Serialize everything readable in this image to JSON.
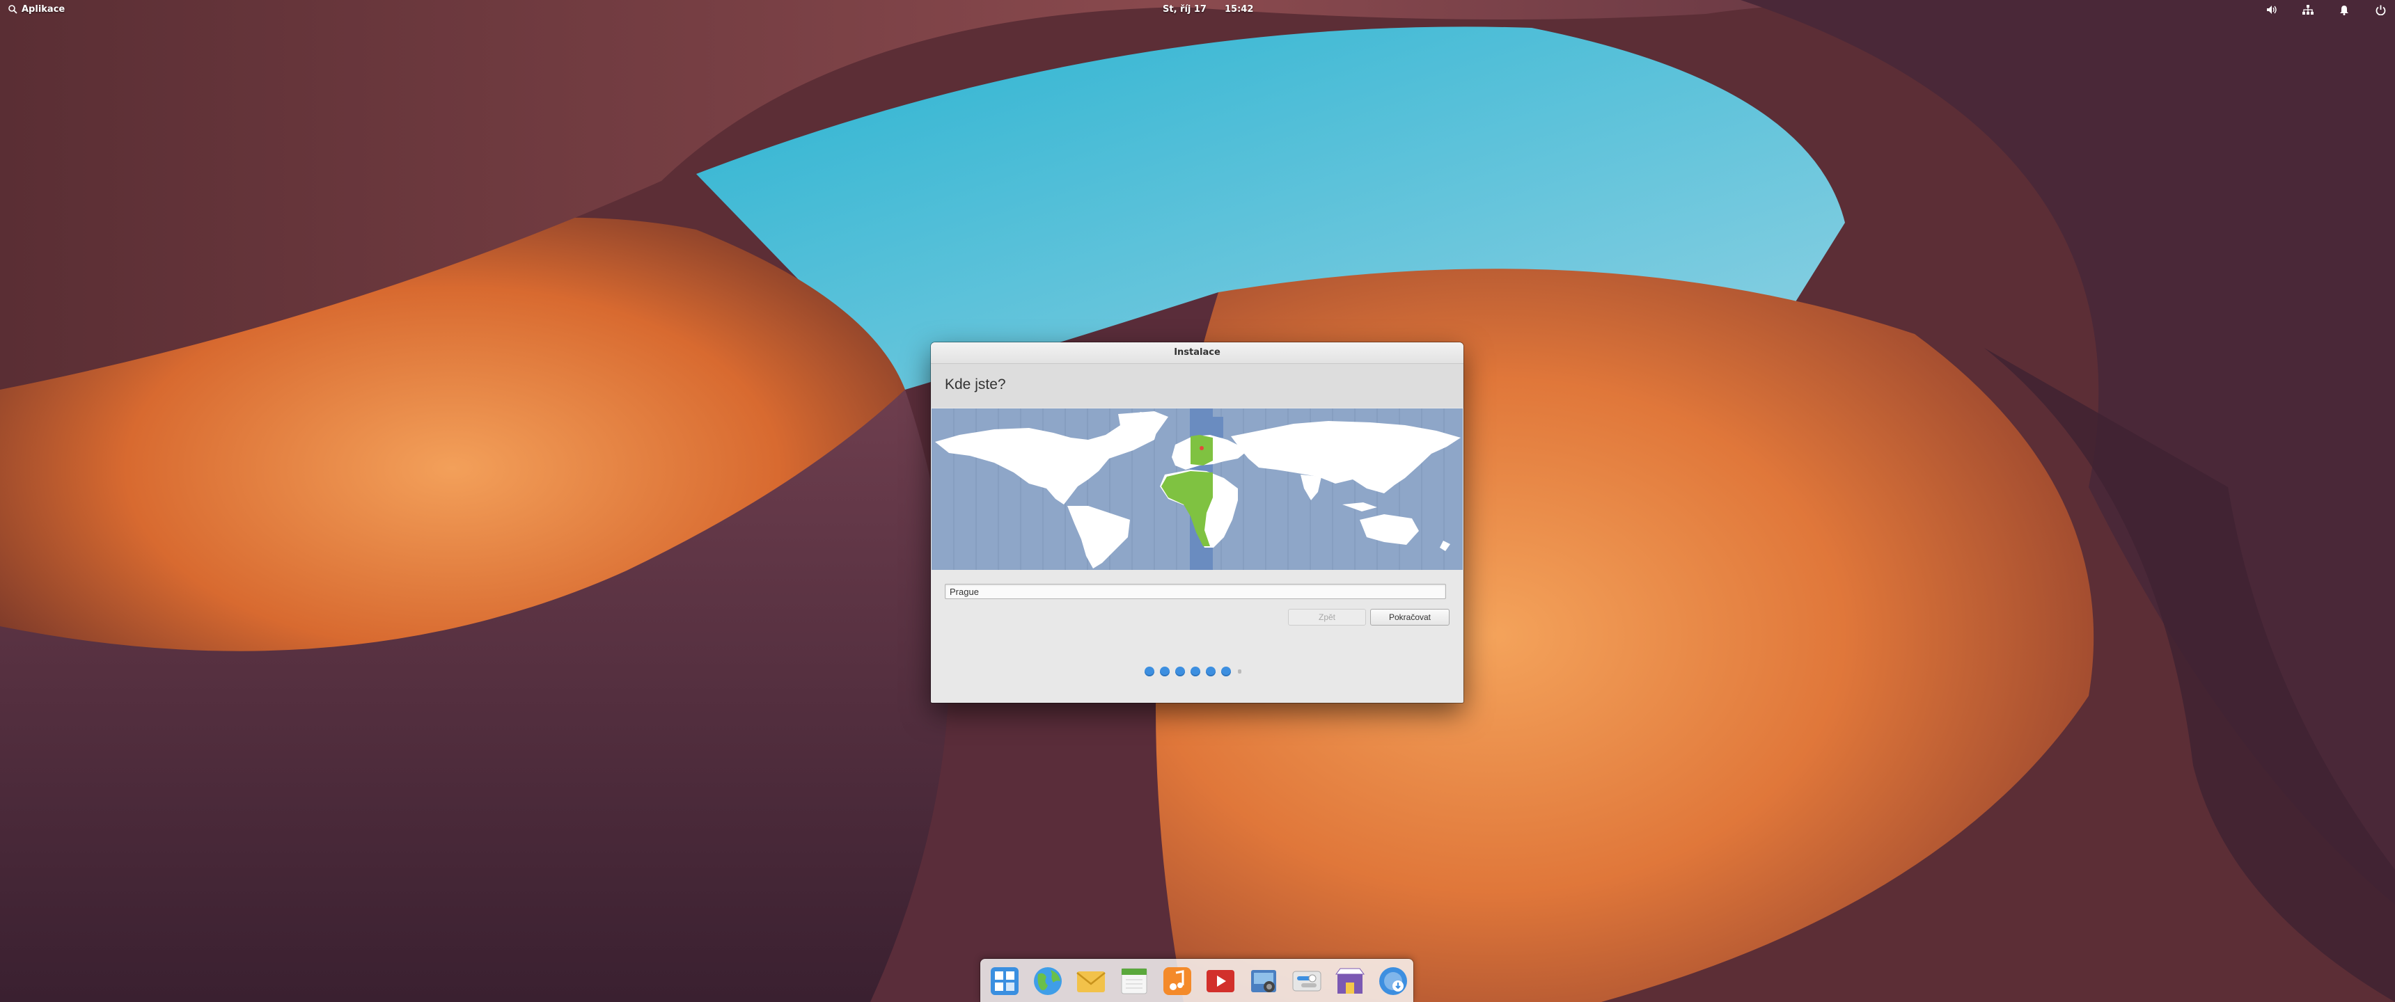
{
  "panel": {
    "applications_label": "Aplikace",
    "date": "St, říj 17",
    "time": "15:42",
    "indicators": [
      "volume-icon",
      "network-icon",
      "notifications-icon",
      "power-icon"
    ]
  },
  "window": {
    "title": "Instalace",
    "heading": "Kde jste?",
    "location_value": "Prague",
    "back_label": "Zpět",
    "continue_label": "Pokračovat",
    "progress": {
      "total_steps": 7,
      "completed_steps": 6
    }
  },
  "dock": {
    "apps": [
      "multitasking-view-icon",
      "web-browser-icon",
      "mail-icon",
      "calendar-icon",
      "music-icon",
      "videos-icon",
      "photos-icon",
      "system-settings-icon",
      "app-center-icon",
      "installer-icon"
    ]
  },
  "colors": {
    "accent": "#3d8fe0",
    "map_ocean": "#8ea6c8",
    "map_selected_zone": "#6a8cc0",
    "map_highlight": "#7fc241",
    "window_bg": "#e8e8e8"
  }
}
